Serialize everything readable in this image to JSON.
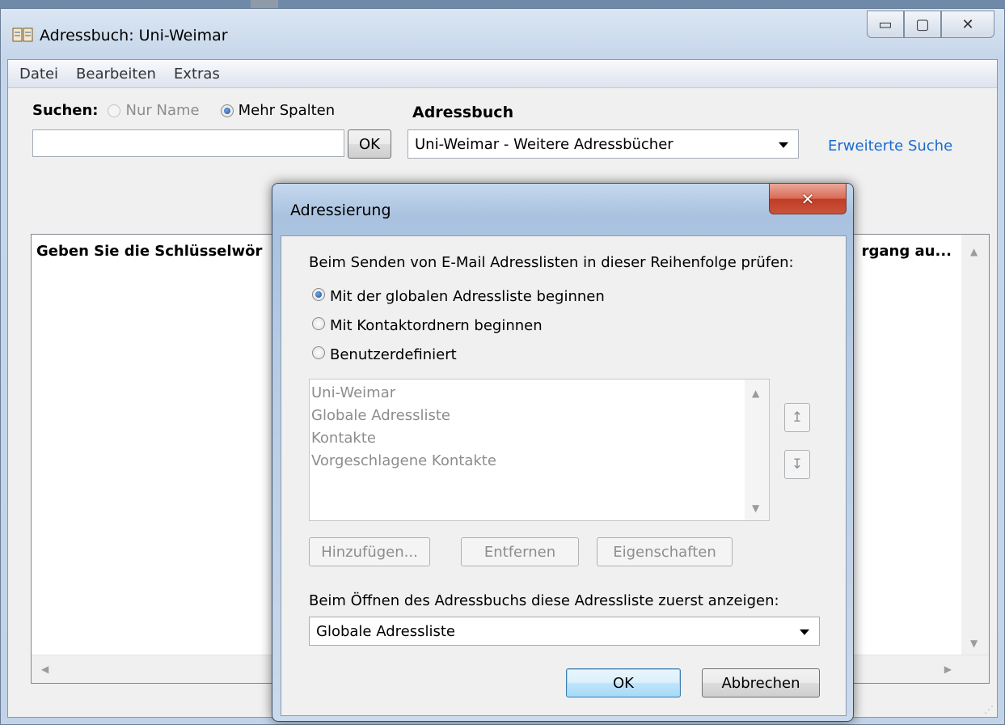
{
  "main_window": {
    "title": "Adressbuch: Uni-Weimar",
    "controls": {
      "minimize": "▭",
      "maximize": "▢",
      "close": "✕"
    },
    "menu": [
      "Datei",
      "Bearbeiten",
      "Extras"
    ],
    "search": {
      "label": "Suchen:",
      "option_name_only": "Nur Name",
      "option_more_columns": "Mehr Spalten",
      "input_value": "",
      "ok_button": "OK"
    },
    "addressbook": {
      "label": "Adressbuch",
      "selected": "Uni-Weimar - Weitere Adressbücher",
      "advanced_search_link": "Erweiterte Suche"
    },
    "results": {
      "header_left": "Geben Sie die Schlüsselwör",
      "header_right": "rgang au..."
    }
  },
  "dialog": {
    "title": "Adressierung",
    "close_glyph": "✕",
    "prompt": "Beim Senden von E-Mail Adresslisten in dieser Reihenfolge prüfen:",
    "options": [
      {
        "label": "Mit der globalen Adressliste beginnen",
        "selected": true
      },
      {
        "label": "Mit Kontaktordnern beginnen",
        "selected": false
      },
      {
        "label": "Benutzerdefiniert",
        "selected": false
      }
    ],
    "list": [
      "Uni-Weimar",
      "Globale Adressliste",
      "Kontakte",
      "Vorgeschlagene Kontakte"
    ],
    "move_up_glyph": "↥",
    "move_down_glyph": "↧",
    "buttons": {
      "add": "Hinzufügen...",
      "remove": "Entfernen",
      "properties": "Eigenschaften"
    },
    "open_label": "Beim Öffnen des Adressbuchs diese Adressliste zuerst anzeigen:",
    "open_selected": "Globale Adressliste",
    "ok": "OK",
    "cancel": "Abbrechen"
  },
  "colors": {
    "link": "#1a6bd0",
    "disabled_text": "#8d8d8d",
    "close_red": "#c13b24"
  }
}
